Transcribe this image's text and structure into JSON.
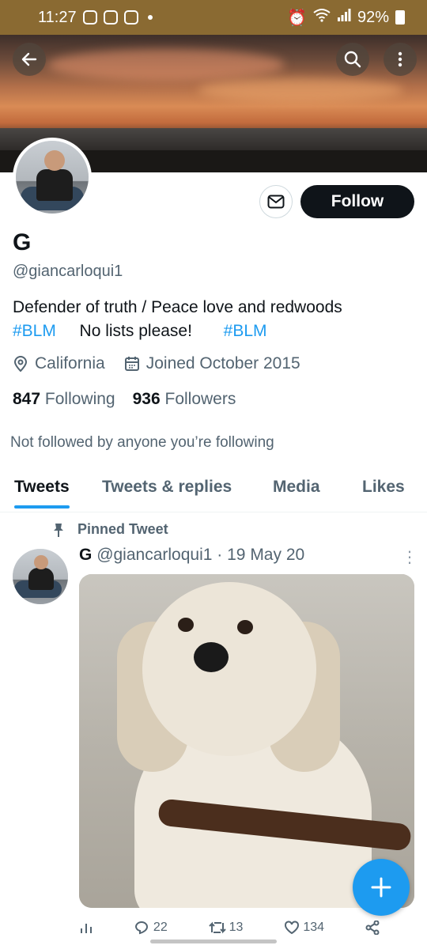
{
  "status_bar": {
    "time": "11:27",
    "battery": "92%"
  },
  "header": {
    "back_icon": "arrow-left-icon",
    "search_icon": "search-icon",
    "more_icon": "more-vertical-icon"
  },
  "profile": {
    "name": "G",
    "handle": "@giancarloqui1",
    "bio_line1": "Defender of truth / Peace love and redwoods",
    "bio_tag1": "#BLM",
    "bio_mid": "No lists please!",
    "bio_tag2": "#BLM",
    "location": "California",
    "joined": "Joined October 2015",
    "following_count": "847",
    "following_label": "Following",
    "followers_count": "936",
    "followers_label": "Followers",
    "not_followed": "Not followed by anyone you’re following",
    "follow_label": "Follow"
  },
  "tabs": [
    "Tweets",
    "Tweets & replies",
    "Media",
    "Likes"
  ],
  "tweet": {
    "pinned_label": "Pinned Tweet",
    "name": "G",
    "handle": "@giancarloqui1",
    "date": "19 May 20",
    "replies": "22",
    "retweets": "13",
    "likes": "134"
  },
  "colors": {
    "accent": "#1d9bf0",
    "status_bar": "#8a6a32",
    "text": "#0f1419",
    "muted": "#536471"
  }
}
